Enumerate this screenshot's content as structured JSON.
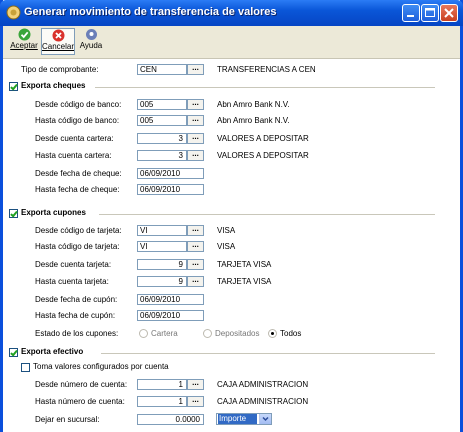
{
  "window": {
    "title": "Generar movimiento de transferencia de valores"
  },
  "toolbar": {
    "accept": "Aceptar",
    "cancel": "Cancelar",
    "help": "Ayuda"
  },
  "tipo": {
    "label": "Tipo de comprobante:",
    "value": "CEN",
    "desc": "TRANSFERENCIAS A CEN"
  },
  "cheques": {
    "title": "Exporta cheques",
    "banco_desde": {
      "label": "Desde código de banco:",
      "value": "005",
      "desc": "Abn Amro Bank N.V."
    },
    "banco_hasta": {
      "label": "Hasta código de banco:",
      "value": "005",
      "desc": "Abn Amro Bank N.V."
    },
    "cartera_desde": {
      "label": "Desde cuenta cartera:",
      "value": "3",
      "desc": "VALORES A DEPOSITAR"
    },
    "cartera_hasta": {
      "label": "Hasta cuenta cartera:",
      "value": "3",
      "desc": "VALORES A DEPOSITAR"
    },
    "fecha_desde": {
      "label": "Desde fecha de cheque:",
      "value": "06/09/2010"
    },
    "fecha_hasta": {
      "label": "Hasta fecha de cheque:",
      "value": "06/09/2010"
    }
  },
  "cupones": {
    "title": "Exporta cupones",
    "tarjeta_desde": {
      "label": "Desde código de tarjeta:",
      "value": "VI",
      "desc": "VISA"
    },
    "tarjeta_hasta": {
      "label": "Hasta código de tarjeta:",
      "value": "VI",
      "desc": "VISA"
    },
    "cuenta_desde": {
      "label": "Desde cuenta tarjeta:",
      "value": "9",
      "desc": "TARJETA VISA"
    },
    "cuenta_hasta": {
      "label": "Hasta cuenta tarjeta:",
      "value": "9",
      "desc": "TARJETA VISA"
    },
    "fecha_desde": {
      "label": "Desde fecha de cupón:",
      "value": "06/09/2010"
    },
    "fecha_hasta": {
      "label": "Hasta fecha de cupón:",
      "value": "06/09/2010"
    },
    "estado": {
      "label": "Estado de los cupones:",
      "options": [
        "Cartera",
        "Depositados",
        "Todos"
      ],
      "selected": "Todos"
    }
  },
  "efectivo": {
    "title": "Exporta efectivo",
    "toma_valores": "Toma valores configurados por cuenta",
    "cuenta_desde": {
      "label": "Desde número de cuenta:",
      "value": "1",
      "desc": "CAJA ADMINISTRACION"
    },
    "cuenta_hasta": {
      "label": "Hasta número de cuenta:",
      "value": "1",
      "desc": "CAJA ADMINISTRACION"
    },
    "sucursal": {
      "label": "Dejar en sucursal:",
      "value": "0.0000",
      "select_value": "Importe"
    }
  },
  "lookup_glyph": "..."
}
